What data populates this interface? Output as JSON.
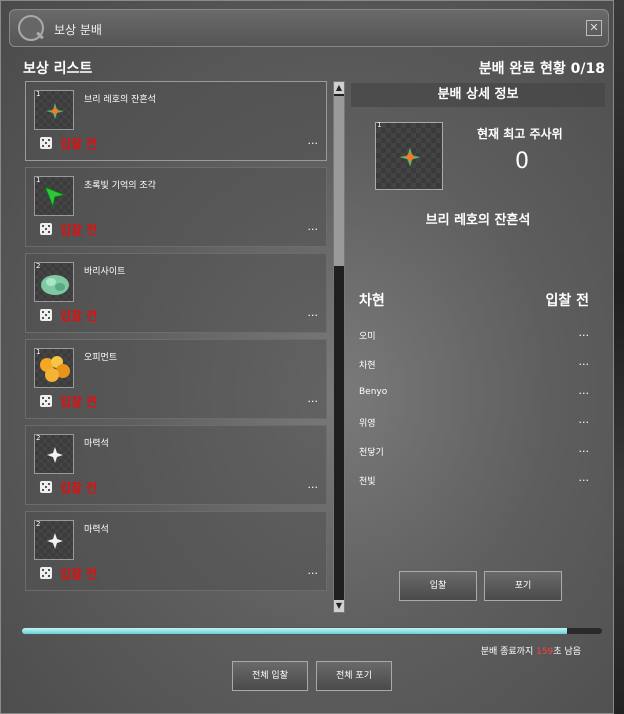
{
  "window": {
    "title": "보상 분배",
    "close": "✕"
  },
  "list": {
    "title": "보상 리스트"
  },
  "progress": {
    "label": "분배 완료 현황",
    "value": "0/18"
  },
  "items": [
    {
      "qty": "1",
      "name": "브리 레호의 잔흔석",
      "status": "입찰 전",
      "more": "...",
      "icon": "shuriken-icon"
    },
    {
      "qty": "1",
      "name": "초록빛 기억의 조각",
      "status": "입찰 전",
      "more": "...",
      "icon": "green-shard-icon"
    },
    {
      "qty": "2",
      "name": "바리사이트",
      "status": "입찰 전",
      "more": "...",
      "icon": "ore-icon"
    },
    {
      "qty": "1",
      "name": "오피먼트",
      "status": "입찰 전",
      "more": "...",
      "icon": "gold-ore-icon"
    },
    {
      "qty": "2",
      "name": "마력석",
      "status": "입찰 전",
      "more": "...",
      "icon": "crystal-icon"
    },
    {
      "qty": "2",
      "name": "마력석",
      "status": "입찰 전",
      "more": "...",
      "icon": "crystal-icon"
    }
  ],
  "detail": {
    "header": "분배 상세 정보",
    "qty": "1",
    "dice_label": "현재 최고 주사위",
    "dice_value": "0",
    "item_name": "브리 레호의 잔흔석",
    "col_left": "차현",
    "col_right": "입찰 전",
    "participants": [
      {
        "name": "오미",
        "value": "..."
      },
      {
        "name": "차현",
        "value": "..."
      },
      {
        "name": "Benyo",
        "value": "..."
      },
      {
        "name": "위영",
        "value": "..."
      },
      {
        "name": "천닿기",
        "value": "..."
      },
      {
        "name": "천빛",
        "value": "..."
      }
    ],
    "bid_button": "입찰",
    "pass_button": "포기"
  },
  "footer": {
    "progress_fraction": 0.94,
    "timer_prefix": "분배 종료까지",
    "timer_value": "159",
    "timer_suffix": "초 남음",
    "bid_all": "전체 입찰",
    "pass_all": "전체 포기"
  },
  "colors": {
    "status": "#e01010",
    "bar": "#6ad0d6",
    "timer": "#ff4040"
  }
}
